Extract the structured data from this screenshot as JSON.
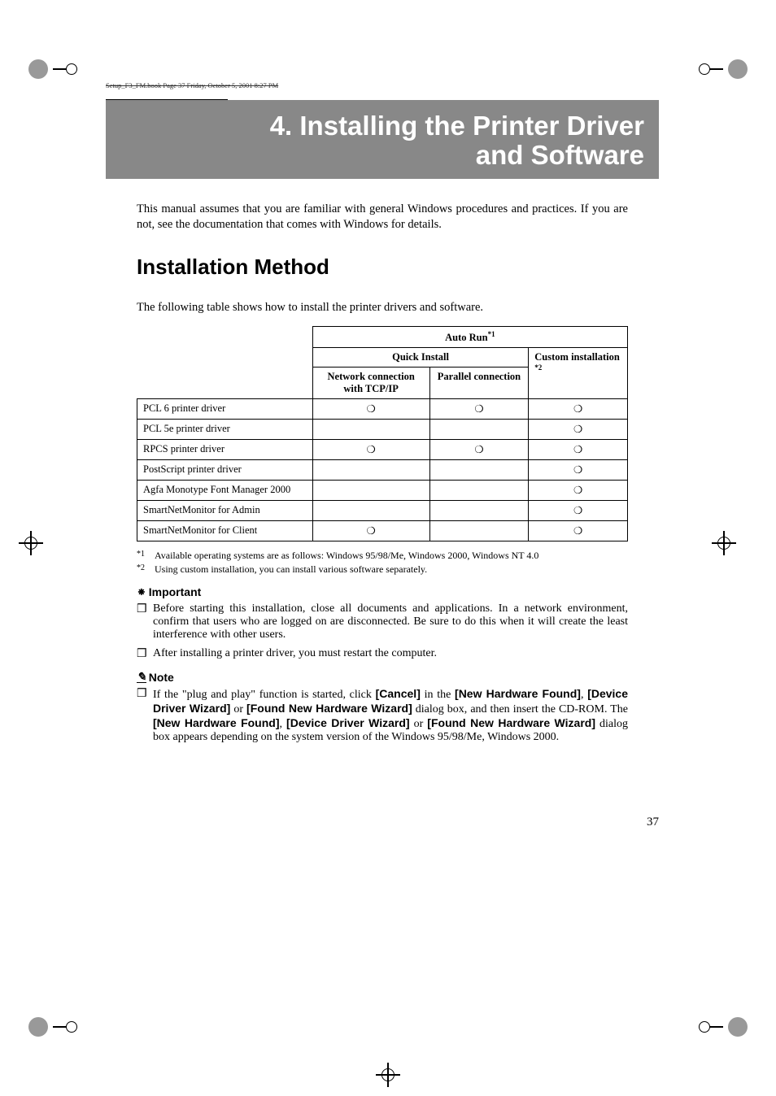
{
  "book_info": "Setup_F3_FM.book  Page 37  Friday, October 5, 2001  8:27 PM",
  "chapter": {
    "title_line1": "4. Installing the Printer Driver",
    "title_line2": "and Software"
  },
  "preamble": "This manual assumes that you are familiar with general Windows procedures and practices. If you are not, see the documentation that comes with Windows for details.",
  "section": {
    "heading": "Installation Method",
    "intro": "The following table shows how to install the printer drivers and software."
  },
  "table": {
    "head": {
      "autorun": "Auto Run",
      "autorun_sup": "*1",
      "quick_install": "Quick Install",
      "custom": "Custom installation",
      "custom_sup": "*2",
      "net": "Network connection with TCP/IP",
      "par": "Parallel connection"
    },
    "rows": [
      {
        "label": "PCL 6 printer driver",
        "net": "❍",
        "par": "❍",
        "custom": "❍"
      },
      {
        "label": "PCL 5e printer driver",
        "net": "",
        "par": "",
        "custom": "❍"
      },
      {
        "label": "RPCS printer driver",
        "net": "❍",
        "par": "❍",
        "custom": "❍"
      },
      {
        "label": "PostScript printer driver",
        "net": "",
        "par": "",
        "custom": "❍"
      },
      {
        "label": "Agfa Monotype Font Manager 2000",
        "net": "",
        "par": "",
        "custom": "❍"
      },
      {
        "label": "SmartNetMonitor for Admin",
        "net": "",
        "par": "",
        "custom": "❍"
      },
      {
        "label": "SmartNetMonitor for Client",
        "net": "❍",
        "par": "",
        "custom": "❍"
      }
    ]
  },
  "footnotes": {
    "f1_mark": "*1",
    "f1_text": "Available operating systems are as follows: Windows 95/98/Me, Windows 2000, Windows NT 4.0",
    "f2_mark": "*2",
    "f2_text": "Using custom installation, you can install various software separately."
  },
  "important": {
    "label": "Important",
    "items": [
      "Before starting this installation, close all documents and applications. In a network environment, confirm that users who are logged on are disconnected. Be sure to do this when it will create the least interference with other users.",
      "After installing a printer driver, you must restart the computer."
    ]
  },
  "note": {
    "label": "Note",
    "prefix": "If the \"plug and play\" function is started, click ",
    "cancel": "[Cancel]",
    "mid1": " in the ",
    "nh1": "[New Hardware Found]",
    "mid2": ", ",
    "ddw1": "[Device Driver Wizard]",
    "mid3": " or ",
    "fnhw1": "[Found New Hardware Wizard]",
    "mid4": " dialog box, and then insert the CD-ROM. The ",
    "nh2": "[New Hardware Found]",
    "mid5": ", ",
    "ddw2": "[Device Driver Wizard]",
    "mid6": " or ",
    "fnhw2": "[Found New Hardware Wizard]",
    "suffix": " dialog box appears depending on the system version of the Windows 95/98/Me, Windows 2000."
  },
  "page_number": "37"
}
